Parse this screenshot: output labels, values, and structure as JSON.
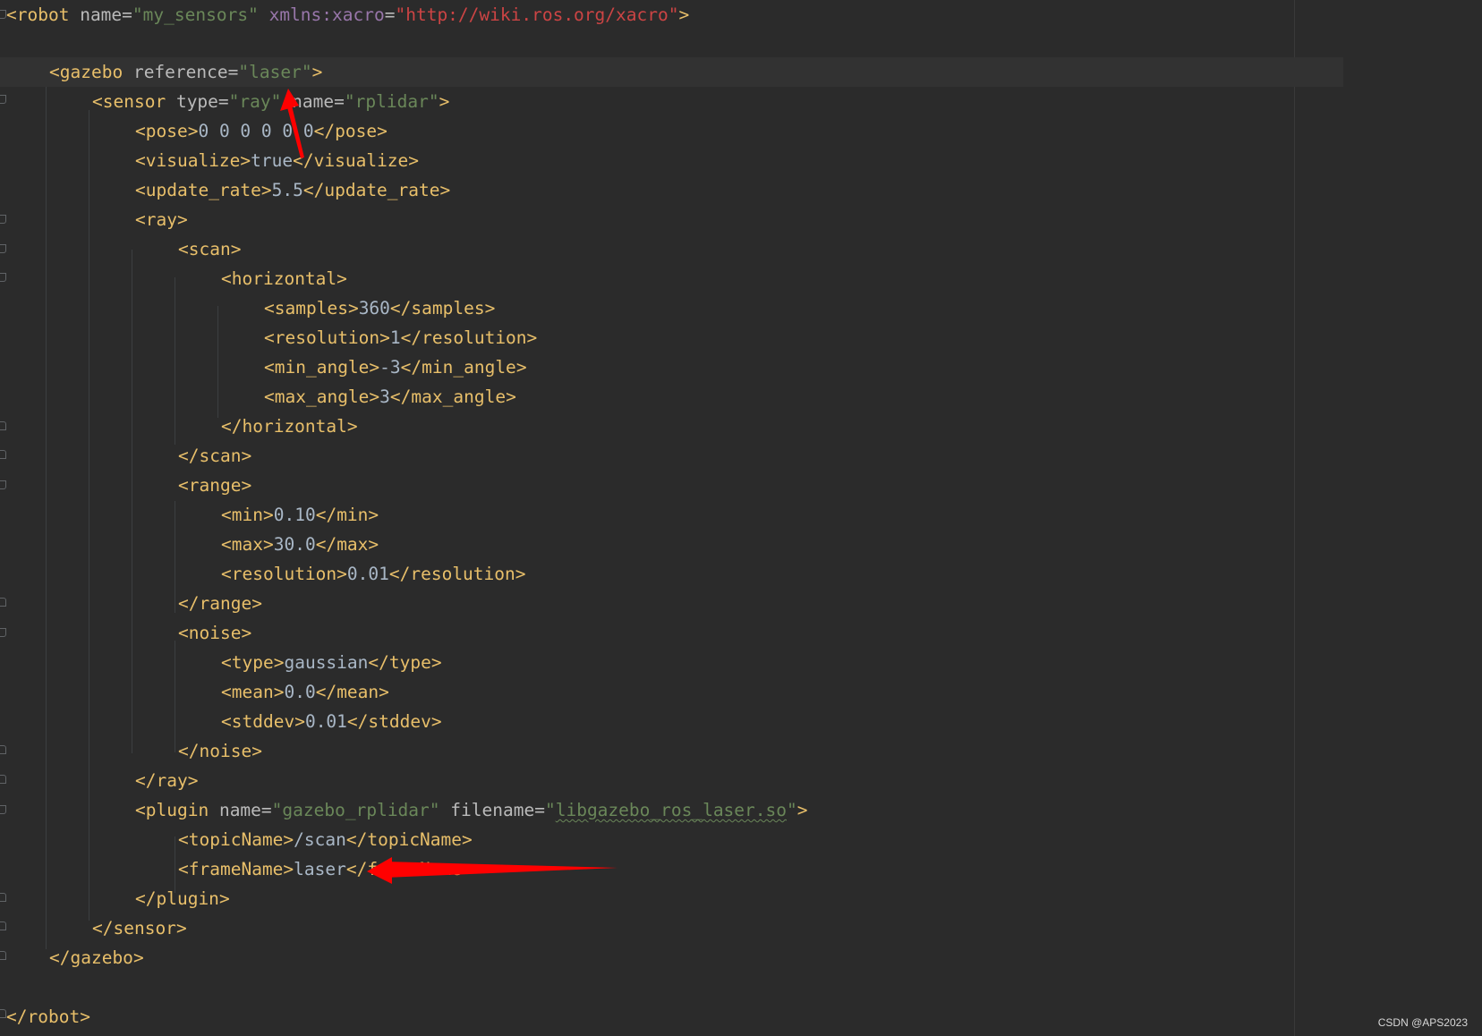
{
  "code": {
    "robot_open": {
      "tag": "robot",
      "name_attr": "name",
      "name_val": "my_sensors",
      "ns_attr": "xmlns:xacro",
      "ns_val": "http://wiki.ros.org/xacro"
    },
    "gazebo_open": {
      "tag": "gazebo",
      "ref_attr": "reference",
      "ref_val": "laser"
    },
    "sensor_open": {
      "tag": "sensor",
      "type_attr": "type",
      "type_val": "ray",
      "name_attr": "name",
      "name_val": "rplidar"
    },
    "pose": {
      "tag": "pose",
      "value": "0 0 0 0 0 0"
    },
    "visualize": {
      "tag": "visualize",
      "value": "true"
    },
    "update_rate": {
      "tag": "update_rate",
      "value": "5.5"
    },
    "ray_tag": "ray",
    "scan_tag": "scan",
    "horizontal_tag": "horizontal",
    "samples": {
      "tag": "samples",
      "value": "360"
    },
    "h_resolution": {
      "tag": "resolution",
      "value": "1"
    },
    "min_angle": {
      "tag": "min_angle",
      "value": "-3"
    },
    "max_angle": {
      "tag": "max_angle",
      "value": "3"
    },
    "range_tag": "range",
    "min": {
      "tag": "min",
      "value": "0.10"
    },
    "max": {
      "tag": "max",
      "value": "30.0"
    },
    "r_resolution": {
      "tag": "resolution",
      "value": "0.01"
    },
    "noise_tag": "noise",
    "type": {
      "tag": "type",
      "value": "gaussian"
    },
    "mean": {
      "tag": "mean",
      "value": "0.0"
    },
    "stddev": {
      "tag": "stddev",
      "value": "0.01"
    },
    "plugin_open": {
      "tag": "plugin",
      "name_attr": "name",
      "name_val": "gazebo_rplidar",
      "file_attr": "filename",
      "file_val": "libgazebo_ros_laser.so"
    },
    "topicName": {
      "tag": "topicName",
      "value": "/scan"
    },
    "frameName": {
      "tag": "frameName",
      "value": "laser"
    },
    "plugin_tag": "plugin",
    "sensor_tag": "sensor",
    "gazebo_tag": "gazebo",
    "robot_tag": "robot"
  },
  "watermark": "CSDN @APS2023",
  "colors": {
    "background": "#2b2b2b",
    "tag": "#e8bf6a",
    "attribute": "#bababa",
    "attribute_value": "#6a8759",
    "url": "#cc4444",
    "annotation_arrow": "#ff0000"
  },
  "annotations": [
    "red-arrow-pointing-to-laser-reference",
    "red-arrow-pointing-to-laser-frame-name"
  ]
}
